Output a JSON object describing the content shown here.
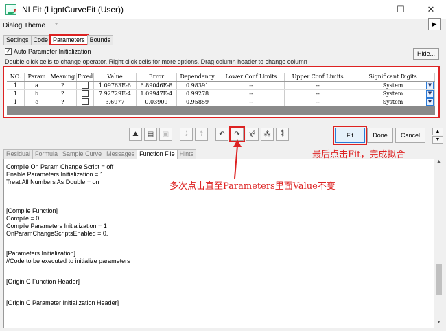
{
  "window": {
    "title": "NLFit (LigntCurveFit (User))",
    "minimize": "—",
    "maximize": "☐",
    "close": "✕"
  },
  "theme": {
    "label": "Dialog Theme",
    "value": "*",
    "arrow": "▶"
  },
  "top_tabs": [
    "Settings",
    "Code",
    "Parameters",
    "Bounds"
  ],
  "auto_param": {
    "label": "Auto Parameter Initialization",
    "checked": "✓"
  },
  "hide_label": "Hide...",
  "hint": "Double click cells to change operator. Right click cells for more options. Drag column header to change column orders.",
  "table": {
    "headers": [
      "NO.",
      "Param",
      "Meaning",
      "Fixed",
      "Value",
      "Error",
      "Dependency",
      "Lower Conf Limits",
      "Upper Conf Limits",
      "Significant Digits"
    ],
    "rows": [
      {
        "no": "1",
        "param": "a",
        "meaning": "?",
        "value": "1.09763E-6",
        "error": "6.89046E-8",
        "dependency": "0.98391",
        "lower": "--",
        "upper": "--",
        "digits": "System"
      },
      {
        "no": "1",
        "param": "b",
        "meaning": "?",
        "value": "7.92729E-4",
        "error": "1.09947E-4",
        "dependency": "0.99278",
        "lower": "--",
        "upper": "--",
        "digits": "System"
      },
      {
        "no": "1",
        "param": "c",
        "meaning": "?",
        "value": "3.6977",
        "error": "0.03909",
        "dependency": "0.95859",
        "lower": "--",
        "upper": "--",
        "digits": "System"
      }
    ]
  },
  "toolbar": {
    "icons": [
      "fit-curve-icon",
      "report-icon",
      "save-icon",
      "param-down-icon",
      "param-up-icon",
      "undo-icon",
      "one-iteration-icon",
      "chi-square-icon",
      "fit-until-converge-icon",
      "dataset-icon"
    ]
  },
  "buttons": {
    "fit": "Fit",
    "done": "Done",
    "cancel": "Cancel"
  },
  "bottom_tabs": [
    "Residual",
    "Formula",
    "Sample Curve",
    "Messages",
    "Function File",
    "Hints"
  ],
  "annotations": {
    "fit_note": "最后点击Fit，完成拟合",
    "iterate_note": "多次点击直至Parameters里面Value不变"
  },
  "code_lines": [
    "Compile On Param Change Script = off",
    "Enable Parameters Initialization = 1",
    "Treat All Numbers As Double = on",
    "",
    "[Compile Function]",
    "Compile = 0",
    "Compile Parameters Initialization = 1",
    "OnParamChangeScriptsEnabled = 0.",
    "",
    "[Parameters Initialization]",
    "//Code to be executed to initialize parameters",
    "",
    "[Origin C Function Header]",
    "",
    "[Origin C Parameter Initialization Header]"
  ],
  "colors": {
    "annotation": "#dd2222",
    "highlight_border": "#dd2222",
    "accent": "#2a7ad6"
  }
}
